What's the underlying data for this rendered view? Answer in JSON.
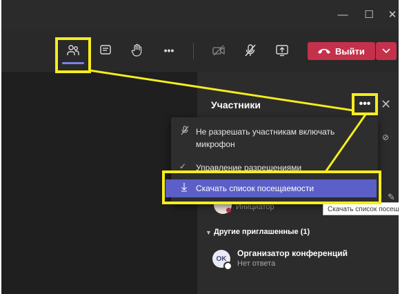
{
  "toolbar": {
    "leave_label": "Выйти"
  },
  "panel": {
    "title": "Участники",
    "more_label": "•••",
    "close_glyph": "✕"
  },
  "menu": {
    "items": [
      {
        "label": "Не разрешать участникам включать микрофон",
        "icon": "mic-off-icon"
      },
      {
        "label": "Управление разрешениями",
        "icon": "check-icon"
      },
      {
        "label": "Скачать список посещаемости",
        "icon": "download-icon"
      }
    ]
  },
  "tooltip": {
    "text": "Скачать список посещаемости"
  },
  "participants": {
    "organizer_role": "Инициатор",
    "invited_header": "Другие приглашенные (1)",
    "invited": [
      {
        "initials": "OK",
        "name": "Организатор конференций",
        "status": "Нет ответа"
      }
    ]
  },
  "colors": {
    "accent": "#5b5fc7",
    "leave": "#c4314b",
    "highlight": "#f5ed1e"
  }
}
